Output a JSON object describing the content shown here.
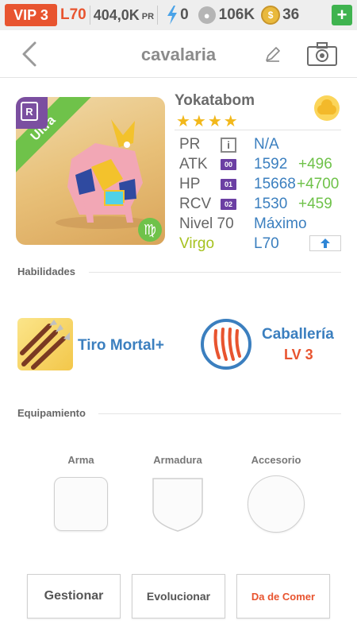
{
  "topbar": {
    "vip": "VIP 3",
    "level": "L70",
    "pr_value": "404,0K",
    "pr_tag": "PR",
    "energy": "0",
    "paw": "106K",
    "coins": "36",
    "plus_label": "+"
  },
  "header": {
    "title": "cavalaria"
  },
  "monster": {
    "rarity": "Ultra",
    "r_badge": "R",
    "zodiac_symbol": "♍",
    "name": "Yokatabom",
    "stars": "★★★★",
    "stats": {
      "pr": {
        "label": "PR",
        "chip": "i",
        "value": "N/A"
      },
      "atk": {
        "label": "ATK",
        "chip": "00",
        "value": "1592",
        "bonus": "+496"
      },
      "hp": {
        "label": "HP",
        "chip": "01",
        "value": "15668",
        "bonus": "+4700"
      },
      "rcv": {
        "label": "RCV",
        "chip": "02",
        "value": "1530",
        "bonus": "+459"
      },
      "level": {
        "label": "Nivel 70",
        "value": "Máximo"
      },
      "zodiac": {
        "label": "Virgo",
        "value": "L70"
      }
    }
  },
  "sections": {
    "skills": "Habilidades",
    "equipment": "Equipamiento"
  },
  "skills": {
    "active_name": "Tiro Mortal+",
    "leader_name": "Caballería",
    "leader_level": "LV 3"
  },
  "equipment": {
    "weapon": "Arma",
    "armor": "Armadura",
    "accessory": "Accesorio"
  },
  "buttons": {
    "manage": "Gestionar",
    "evolve": "Evolucionar",
    "feed": "Da de Comer"
  },
  "colors": {
    "accent_orange": "#e8542f",
    "stat_blue": "#3b7fbf",
    "bonus_green": "#6fc24a",
    "star_gold": "#f2b81b",
    "zodiac_green": "#a6c21f"
  }
}
